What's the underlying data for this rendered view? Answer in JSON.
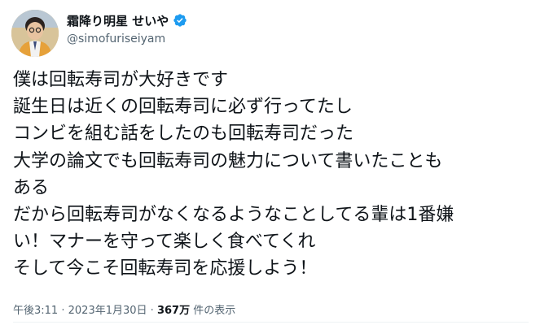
{
  "user": {
    "display_name": "霜降り明星 せいや",
    "handle": "@simofuriseiyam",
    "verified_icon": "verified-badge-icon",
    "accent_color": "#1d9bf0"
  },
  "tweet": {
    "lines": [
      "僕は回転寿司が大好きです",
      "誕生日は近くの回転寿司に必ず行ってたし",
      "コンビを組む話をしたのも回転寿司だった",
      "大学の論文でも回転寿司の魅力について書いたことも",
      "ある",
      "だから回転寿司がなくなるようなことしてる輩は1番嫌",
      "い！マナーを守って楽しく食べてくれ",
      "そして今こそ回転寿司を応援しよう！"
    ]
  },
  "meta": {
    "time": "午後3:11",
    "separator": "·",
    "date": "2023年1月30日",
    "views_count": "367万",
    "views_label": "件の表示"
  }
}
